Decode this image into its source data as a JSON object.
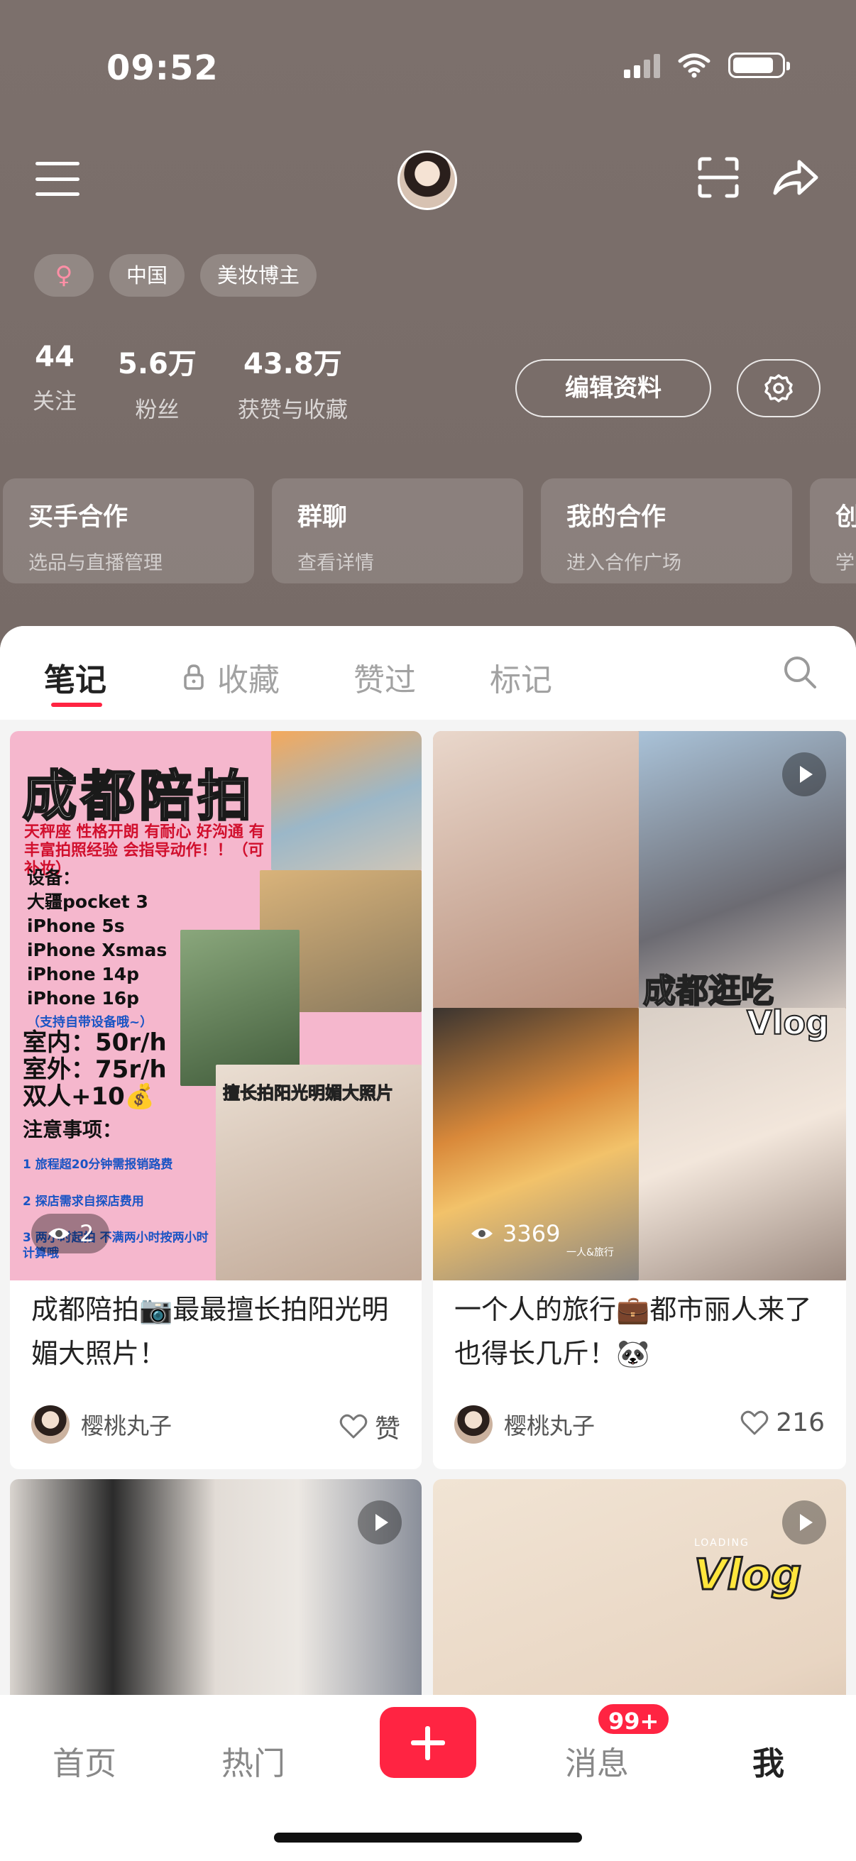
{
  "status_bar": {
    "time": "09:52"
  },
  "profile": {
    "tags": [
      "♀",
      "中国",
      "美妆博主"
    ],
    "stats": [
      {
        "num": "44",
        "label": "关注"
      },
      {
        "num": "5.6万",
        "label": "粉丝"
      },
      {
        "num": "43.8万",
        "label": "获赞与收藏"
      }
    ],
    "edit_label": "编辑资料"
  },
  "cards": [
    {
      "title": "买手合作",
      "sub": "选品与直播管理"
    },
    {
      "title": "群聊",
      "sub": "查看详情"
    },
    {
      "title": "我的合作",
      "sub": "进入合作广场"
    },
    {
      "title": "创",
      "sub": "学"
    }
  ],
  "tabs": [
    "笔记",
    "收藏",
    "赞过",
    "标记"
  ],
  "notes": [
    {
      "title": "成都陪拍📷最最擅长拍阳光明媚大照片！",
      "author": "樱桃丸子",
      "likes": "赞",
      "views": "2",
      "image_text": {
        "headline": "成都陪拍",
        "subline": "天秤座 性格开朗 有耐心 好沟通 有丰富拍照经验 会指导动作！！（可补妆）",
        "equip_title": "设备：",
        "equip": [
          "大疆pocket 3",
          "iPhone 5s",
          "iPhone Xsmas",
          "iPhone 14p",
          "iPhone 16p",
          "（支持自带设备哦~）"
        ],
        "price": [
          "室内：50r/h",
          "室外：75r/h",
          "双人+10💰"
        ],
        "note_title": "注意事项：",
        "note_items": [
          "1 旅程超20分钟需报销路费",
          "2 探店需求自探店费用",
          "3 两小时起拍 不满两小时按两小时计算哦"
        ],
        "banner": "擅长拍阳光明媚大照片"
      }
    },
    {
      "title": "一个人的旅行💼都市丽人来了也得长几斤！🐼",
      "author": "樱桃丸子",
      "likes": "216",
      "views": "3369",
      "image_text": {
        "overlay1": "成都逛吃",
        "overlay2": "Vlog",
        "watermark": "一人&旅行"
      }
    },
    {
      "title": "",
      "author": "",
      "likes": ""
    },
    {
      "title": "",
      "author": "",
      "likes": "",
      "image_text": {
        "overlay": "Vlog",
        "loading": "LOADING"
      }
    }
  ],
  "bottom_nav": {
    "home": "首页",
    "hot": "热门",
    "messages": "消息",
    "me": "我",
    "badge": "99+"
  }
}
